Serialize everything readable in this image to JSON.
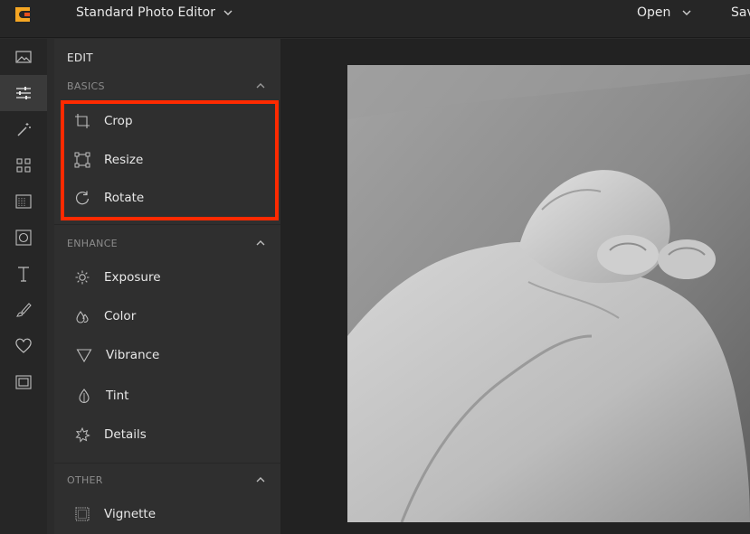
{
  "topbar": {
    "app_title": "Standard Photo Editor",
    "open_label": "Open",
    "save_label": "Save"
  },
  "rail": {
    "items": [
      {
        "icon": "image-icon"
      },
      {
        "icon": "sliders-icon",
        "active": true
      },
      {
        "icon": "magic-wand-icon"
      },
      {
        "icon": "grid-icon"
      },
      {
        "icon": "texture-icon"
      },
      {
        "icon": "frame-icon"
      },
      {
        "icon": "text-icon"
      },
      {
        "icon": "brush-icon"
      },
      {
        "icon": "heart-icon"
      },
      {
        "icon": "border-icon"
      }
    ]
  },
  "panel": {
    "title": "EDIT",
    "sections": {
      "basics": {
        "label": "BASICS",
        "items": [
          "Crop",
          "Resize",
          "Rotate"
        ]
      },
      "enhance": {
        "label": "ENHANCE",
        "items": [
          "Exposure",
          "Color",
          "Vibrance",
          "Tint",
          "Details"
        ]
      },
      "other": {
        "label": "OTHER",
        "items": [
          "Vignette"
        ]
      }
    }
  },
  "colors": {
    "accent": "#ff2a00",
    "logo_orange": "#f5a623"
  }
}
